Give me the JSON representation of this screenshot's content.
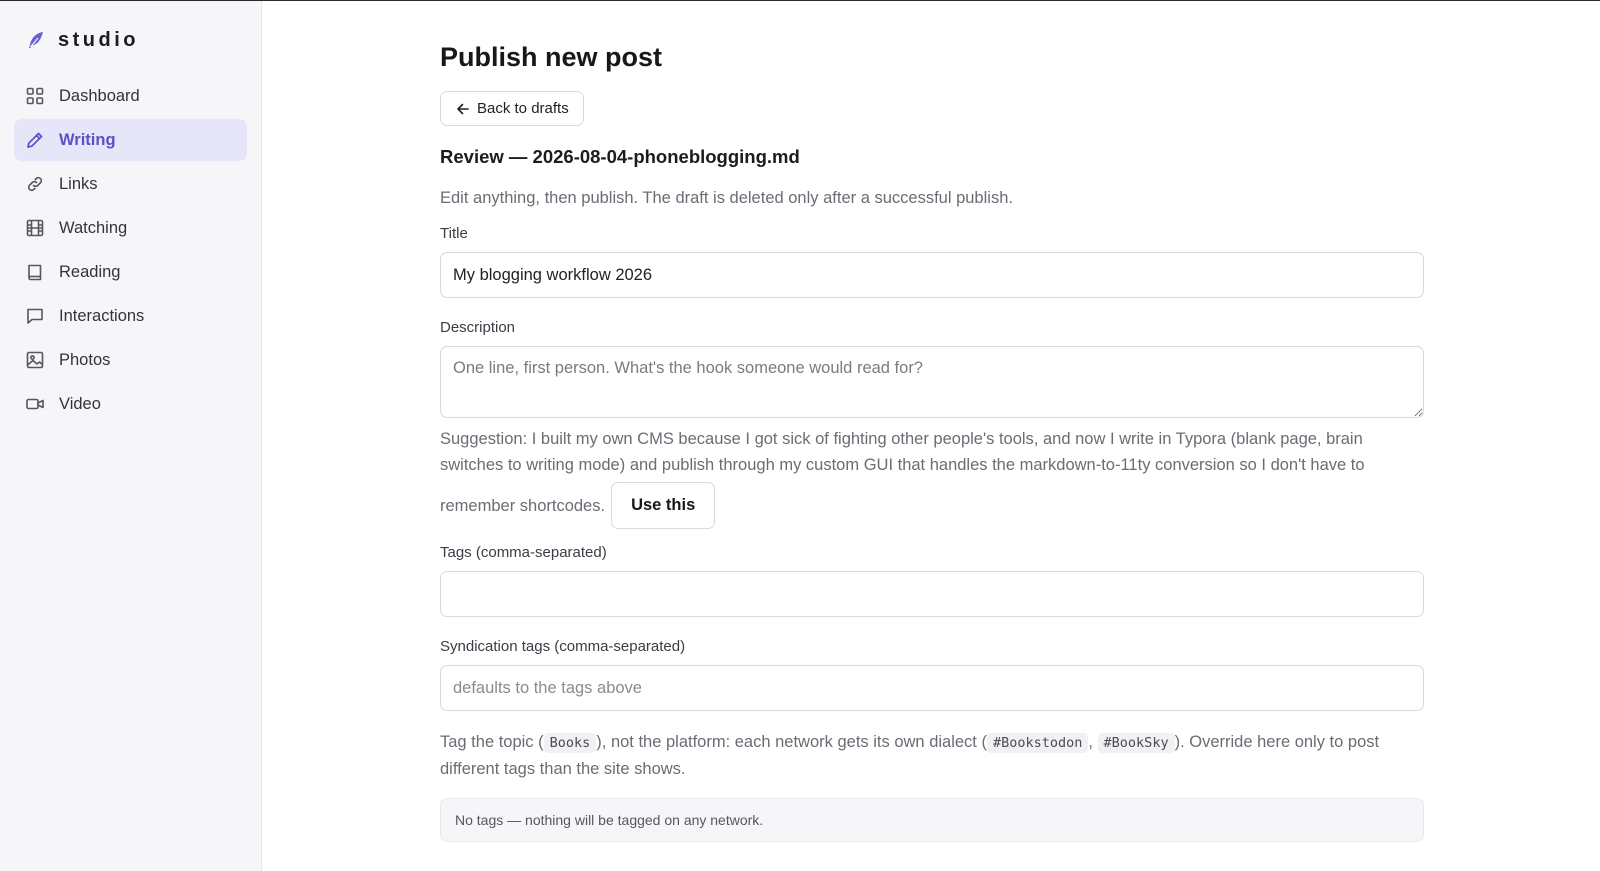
{
  "brand": {
    "name": "studio",
    "color": "#6a5fd3"
  },
  "sidebar": {
    "items": [
      {
        "label": "Dashboard",
        "icon": "grid-icon",
        "active": false
      },
      {
        "label": "Writing",
        "icon": "pencil-icon",
        "active": true
      },
      {
        "label": "Links",
        "icon": "link-icon",
        "active": false
      },
      {
        "label": "Watching",
        "icon": "film-icon",
        "active": false
      },
      {
        "label": "Reading",
        "icon": "book-icon",
        "active": false
      },
      {
        "label": "Interactions",
        "icon": "chat-bubble-icon",
        "active": false
      },
      {
        "label": "Photos",
        "icon": "image-icon",
        "active": false
      },
      {
        "label": "Video",
        "icon": "video-camera-icon",
        "active": false
      }
    ]
  },
  "main": {
    "page_title": "Publish new post",
    "back_label": "Back to drafts",
    "review_title": "Review — 2026-08-04-phoneblogging.md",
    "intro": "Edit anything, then publish. The draft is deleted only after a successful publish.",
    "title_field": {
      "label": "Title",
      "value": "My blogging workflow 2026"
    },
    "description_field": {
      "label": "Description",
      "placeholder": "One line, first person. What's the hook someone would read for?"
    },
    "suggestion": {
      "line1": "Suggestion: I built my own CMS because I got sick of fighting other people's tools, and now I write in Typora (blank page, brain switches to writing mode) and publish through my custom GUI that handles the markdown-to-11ty conversion so I don't have to",
      "line2": "remember shortcodes.",
      "use_label": "Use this"
    },
    "tags_field": {
      "label": "Tags (comma-separated)",
      "value": ""
    },
    "syndication_field": {
      "label": "Syndication tags (comma-separated)",
      "placeholder": "defaults to the tags above"
    },
    "help": {
      "part1": "Tag the topic (",
      "code1": "Books",
      "part2": "), not the platform: each network gets its own dialect (",
      "code2": "#Bookstodon",
      "sep": ", ",
      "code3": "#BookSky",
      "part3": "). Override here only to post different tags than the site shows."
    },
    "notice": "No tags — nothing will be tagged on any network."
  },
  "colors": {
    "accent": "#5b50c4",
    "active_bg": "#e7e6f8",
    "sidebar_bg": "#f6f6f9"
  }
}
